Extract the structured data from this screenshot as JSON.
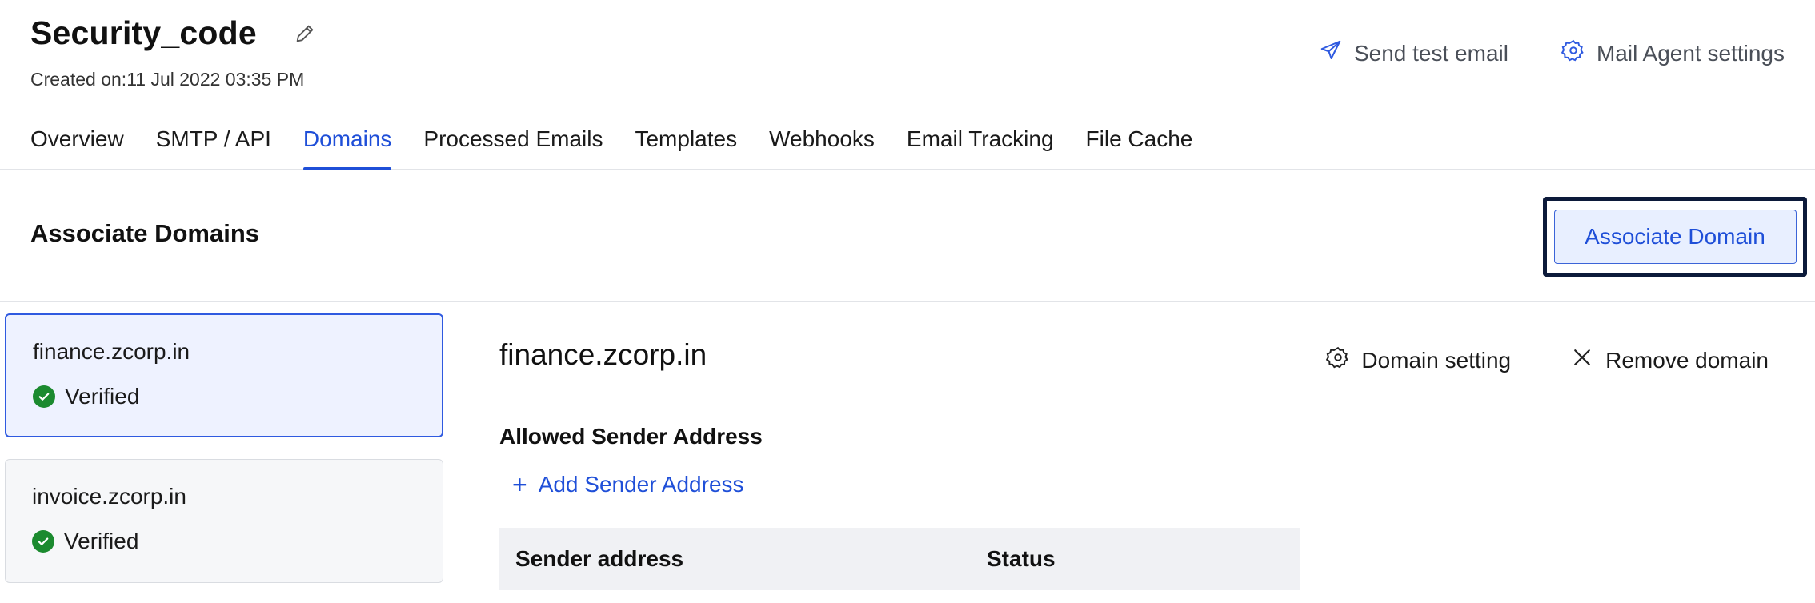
{
  "header": {
    "title": "Security_code",
    "created": "Created on:11 Jul 2022 03:35 PM",
    "actions": {
      "send_test_email": "Send test email",
      "mail_agent_settings": "Mail Agent settings"
    }
  },
  "tabs": [
    {
      "label": "Overview",
      "active": false
    },
    {
      "label": "SMTP / API",
      "active": false
    },
    {
      "label": "Domains",
      "active": true
    },
    {
      "label": "Processed Emails",
      "active": false
    },
    {
      "label": "Templates",
      "active": false
    },
    {
      "label": "Webhooks",
      "active": false
    },
    {
      "label": "Email Tracking",
      "active": false
    },
    {
      "label": "File Cache",
      "active": false
    }
  ],
  "section": {
    "title": "Associate Domains",
    "associate_button": "Associate Domain"
  },
  "domains": [
    {
      "name": "finance.zcorp.in",
      "status": "Verified",
      "selected": true
    },
    {
      "name": "invoice.zcorp.in",
      "status": "Verified",
      "selected": false
    }
  ],
  "detail": {
    "title": "finance.zcorp.in",
    "domain_setting": "Domain setting",
    "remove_domain": "Remove domain",
    "allowed_sender_label": "Allowed Sender Address",
    "add_sender": "Add Sender Address",
    "table_headers": {
      "sender": "Sender address",
      "status": "Status"
    }
  },
  "colors": {
    "accent": "#1f4fd8",
    "verified": "#1b8a2f",
    "focus_outline": "#0c1a3a"
  }
}
